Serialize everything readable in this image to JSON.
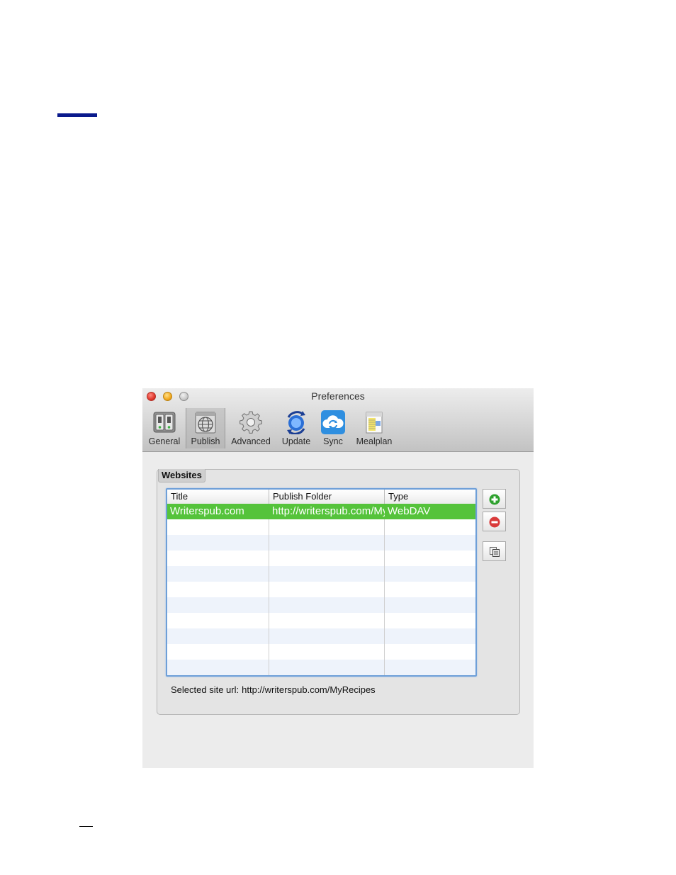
{
  "window": {
    "title": "Preferences"
  },
  "toolbar": {
    "items": [
      {
        "label": "General",
        "icon": "general-switches-icon"
      },
      {
        "label": "Publish",
        "icon": "publish-globe-icon",
        "selected": true
      },
      {
        "label": "Advanced",
        "icon": "gear-icon"
      },
      {
        "label": "Update",
        "icon": "update-globe-icon"
      },
      {
        "label": "Sync",
        "icon": "cloud-sync-icon"
      },
      {
        "label": "Mealplan",
        "icon": "calendar-icon"
      }
    ]
  },
  "websites": {
    "group_label": "Websites",
    "columns": [
      "Title",
      "Publish Folder",
      "Type"
    ],
    "rows": [
      {
        "title": "Writerspub.com",
        "folder": "http://writerspub.com/MyRecipes",
        "type": "WebDAV",
        "selected": true
      }
    ],
    "add_icon": "add-icon",
    "remove_icon": "remove-icon",
    "duplicate_icon": "duplicate-icon",
    "selected_url_label": "Selected site url:",
    "selected_url_value": "http://writerspub.com/MyRecipes"
  },
  "colors": {
    "selection": "#55c33b",
    "table_border": "#6e9fd8",
    "page_rule": "#0a1a8c"
  }
}
